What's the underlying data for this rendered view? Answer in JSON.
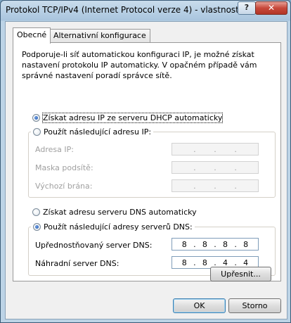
{
  "window": {
    "title": "Protokol TCP/IPv4 (Internet Protocol verze 4) - vlastnosti",
    "help_label": "?",
    "close_label": "✕"
  },
  "tabs": [
    {
      "label": "Obecné",
      "active": true
    },
    {
      "label": "Alternativní konfigurace",
      "active": false
    }
  ],
  "description": "Podporuje-li síť automatickou konfiguraci IP, je možné získat nastavení protokolu IP automaticky. V opačném případě vám správné nastavení poradí správce sítě.",
  "ip_section": {
    "auto_option": {
      "label": "Získat adresu IP ze serveru DHCP automaticky",
      "checked": true
    },
    "manual_option": {
      "label": "Použít následující adresu IP:",
      "checked": false
    },
    "fields": [
      {
        "label": "Adresa IP:",
        "value": [
          ". ",
          ". ",
          ". "
        ]
      },
      {
        "label": "Maska podsítě:",
        "value": [
          ". ",
          ". ",
          ". "
        ]
      },
      {
        "label": "Výchozí brána:",
        "value": [
          ". ",
          ". ",
          ". "
        ]
      }
    ]
  },
  "dns_section": {
    "auto_option": {
      "label": "Získat adresu serveru DNS automaticky",
      "checked": false
    },
    "manual_option": {
      "label": "Použít následující adresy serverů DNS:",
      "checked": true
    },
    "preferred": {
      "label": "Upřednostňovaný server DNS:",
      "octets": [
        "8",
        "8",
        "8",
        "8"
      ]
    },
    "alternate": {
      "label": "Náhradní server DNS:",
      "octets": [
        "8",
        "8",
        "4",
        "4"
      ]
    }
  },
  "buttons": {
    "advanced": "Upřesnit...",
    "ok": "OK",
    "cancel": "Storno"
  }
}
